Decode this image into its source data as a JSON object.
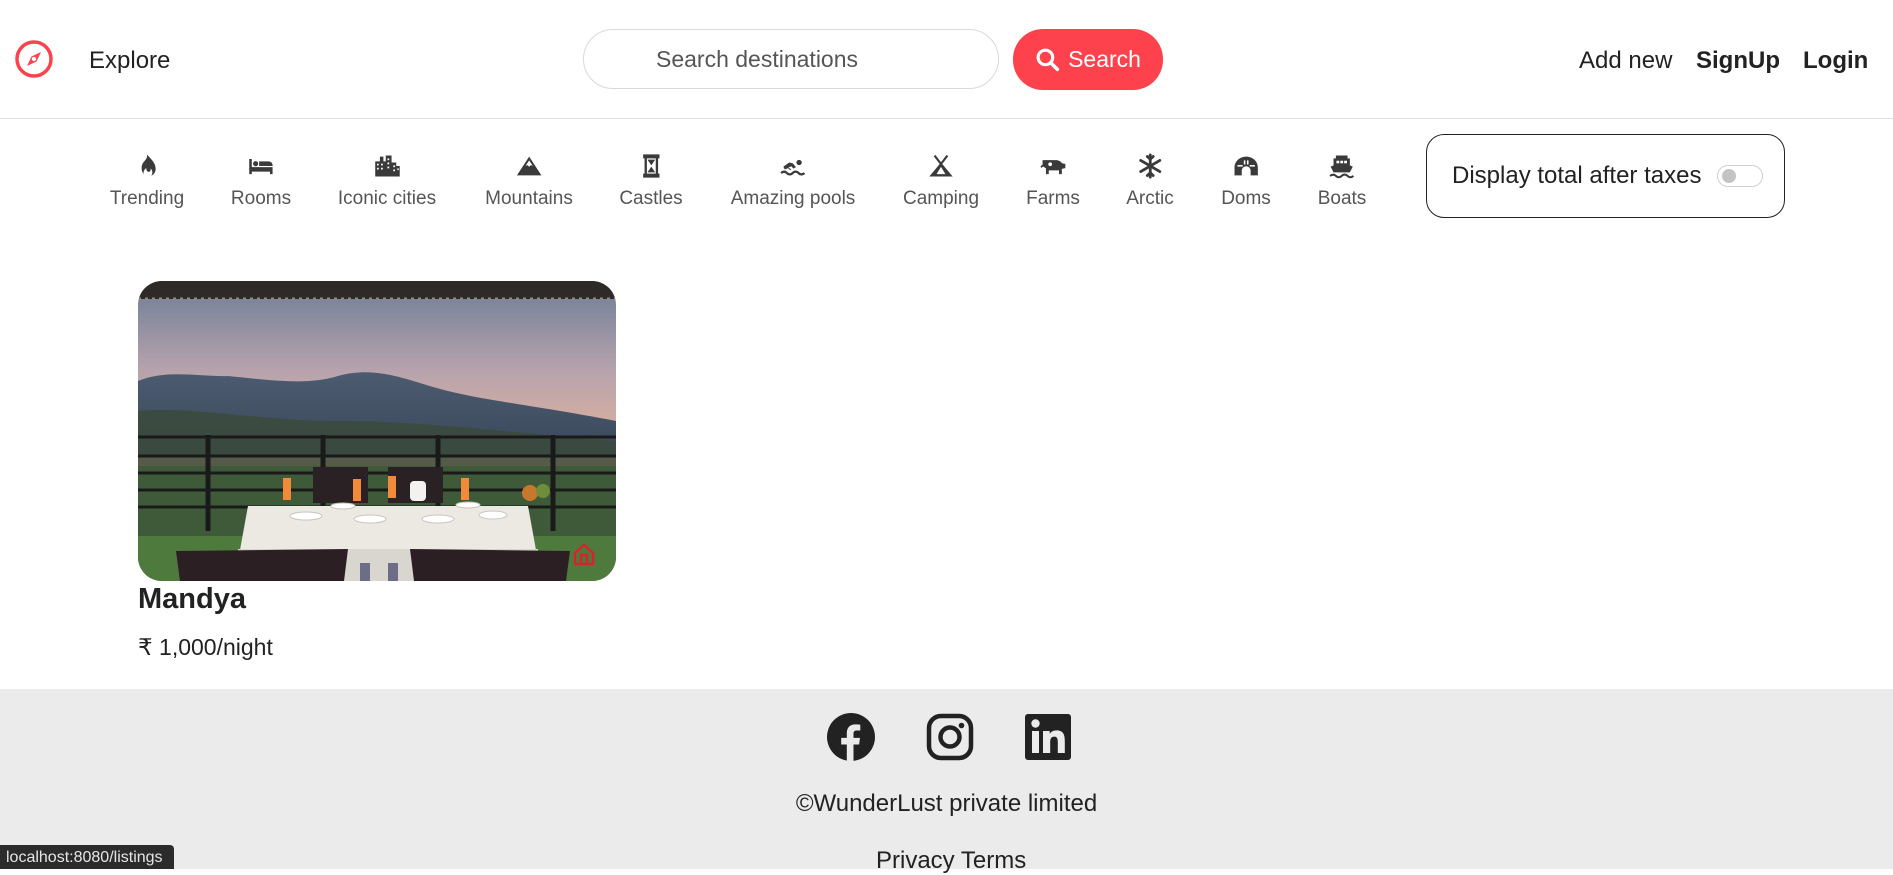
{
  "navbar": {
    "brand_icon": "compass-icon",
    "explore_label": "Explore",
    "search": {
      "placeholder": "Search destinations",
      "value": "",
      "button_label": "Search",
      "button_icon": "search-icon"
    },
    "links": {
      "add_new": "Add new",
      "signup": "SignUp",
      "login": "Login"
    }
  },
  "filters": {
    "items": [
      {
        "label": "Trending",
        "icon": "fire-icon"
      },
      {
        "label": "Rooms",
        "icon": "bed-icon"
      },
      {
        "label": "Iconic cities",
        "icon": "city-icon"
      },
      {
        "label": "Mountains",
        "icon": "mountain-icon"
      },
      {
        "label": "Castles",
        "icon": "castle-icon"
      },
      {
        "label": "Amazing pools",
        "icon": "swimmer-icon"
      },
      {
        "label": "Camping",
        "icon": "tent-icon"
      },
      {
        "label": "Farms",
        "icon": "cow-icon"
      },
      {
        "label": "Arctic",
        "icon": "snowflake-icon"
      },
      {
        "label": "Doms",
        "icon": "igloo-icon"
      },
      {
        "label": "Boats",
        "icon": "ferry-icon"
      }
    ],
    "tax_toggle": {
      "label": "Display total after taxes",
      "checked": false
    }
  },
  "listings": [
    {
      "title": "Mandya",
      "price": "₹ 1,000/night"
    }
  ],
  "footer": {
    "social": [
      "facebook-icon",
      "instagram-icon",
      "linkedin-icon"
    ],
    "copyright": "©WunderLust private limited",
    "links": {
      "privacy": "Privacy",
      "terms": "Terms"
    }
  },
  "status_bar": {
    "url": "localhost:8080/listings"
  },
  "colors": {
    "brand": "#fe424d",
    "footer_bg": "#ebebeb",
    "text": "#222222"
  }
}
